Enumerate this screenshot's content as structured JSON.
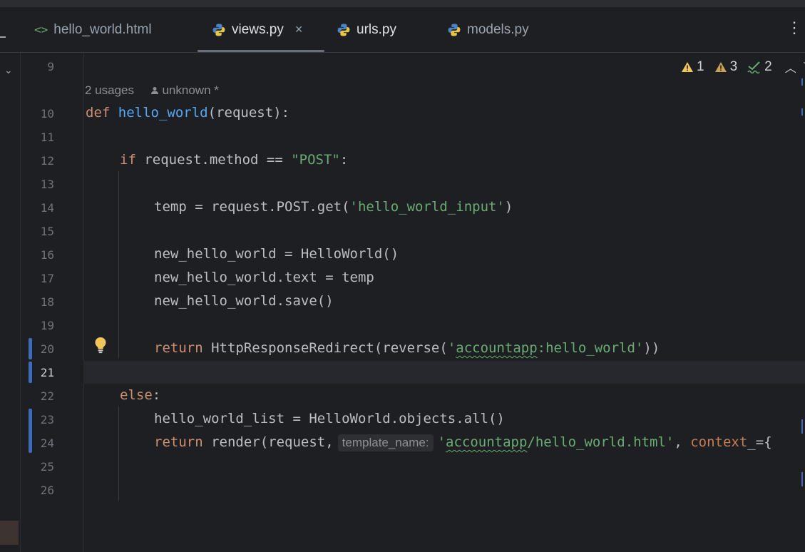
{
  "tabs": [
    {
      "label": "hello_world.html",
      "icon": "html-icon",
      "active": false
    },
    {
      "label": "views.py",
      "icon": "python-icon",
      "active": true,
      "close": "×"
    },
    {
      "label": "urls.py",
      "icon": "python-icon",
      "active": false
    },
    {
      "label": "models.py",
      "icon": "python-icon",
      "active": false
    }
  ],
  "inspections": {
    "errors": "1",
    "warnings": "3",
    "typos": "2"
  },
  "code_vision": {
    "usages": "2 usages",
    "author": "unknown *"
  },
  "line_numbers": [
    "9",
    "10",
    "11",
    "12",
    "13",
    "14",
    "15",
    "16",
    "17",
    "18",
    "19",
    "20",
    "21",
    "22",
    "23",
    "24",
    "25",
    "26"
  ],
  "current_line": "21",
  "code": {
    "l10_kw": "def",
    "l10_fn": "hello_world",
    "l10_rest": "(request):",
    "l12_kw": "if",
    "l12_mid": " request.method == ",
    "l12_str": "\"POST\"",
    "l12_end": ":",
    "l14_pre": "temp = request.POST.get(",
    "l14_str": "'hello_world_input'",
    "l14_end": ")",
    "l16": "new_hello_world = HelloWorld()",
    "l17": "new_hello_world.text = temp",
    "l18": "new_hello_world.save()",
    "l20_kw": "return",
    "l20_mid": " HttpResponseRedirect(reverse(",
    "l20_q1": "'",
    "l20_str_sq": "accountapp",
    "l20_str_rest": ":hello_world'",
    "l20_end": "))",
    "l22_kw": "else",
    "l22_end": ":",
    "l23": "hello_world_list = HelloWorld.objects.all()",
    "l24_kw": "return",
    "l24_mid": " render(request,",
    "l24_hint": "template_name:",
    "l24_q1": "'",
    "l24_str_sq": "accountapp",
    "l24_str_rest": "/hello_world.html'",
    "l24_comma": ", ",
    "l24_param": "context",
    "l24_tail": "_=",
    "l24_overflow": "{"
  },
  "colors": {
    "keyword": "#cf8e6d",
    "function": "#56a8f5",
    "string": "#6aab73",
    "param": "#c77d55",
    "change_marker": "#3f6bb8"
  }
}
